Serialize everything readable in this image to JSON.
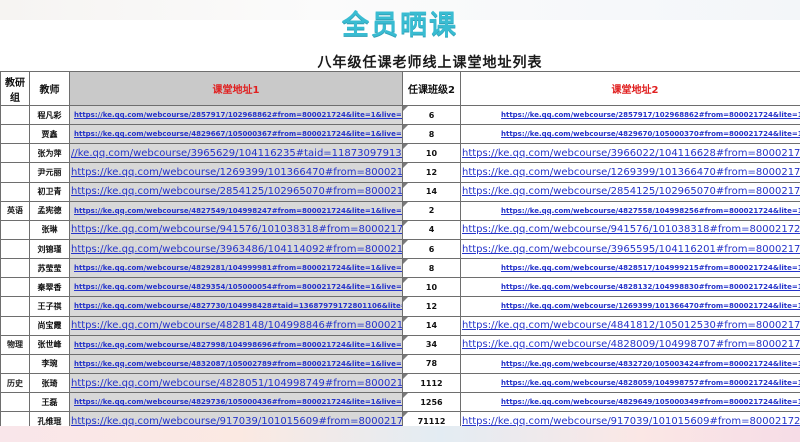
{
  "banner": {
    "title": "全员晒课"
  },
  "sheet": {
    "title": "八年级任课老师线上课堂地址列表",
    "headers": {
      "group": "教研组",
      "teacher": "教师",
      "url1": "课堂地址1",
      "class": "任课班级2",
      "url2": "课堂地址2"
    },
    "group_labels": {
      "english": "英语",
      "physics": "物理",
      "history": "历史"
    },
    "rows": [
      {
        "teacher": "程凡彩",
        "url1": "https://ke.qq.com/webcourse/2857917/102968862#from=800021724&lite=1&live=1",
        "cls": "6",
        "url2": "https://ke.qq.com/webcourse/2857917/102968862#from=800021724&lite=1&live=1",
        "s1": "small",
        "s2": "small"
      },
      {
        "teacher": "贾鑫",
        "url1": "https://ke.qq.com/webcourse/4829667/105000367#from=800021724&lite=1&live=1",
        "cls": "8",
        "url2": "https://ke.qq.com/webcourse/4829670/105000370#from=800021724&lite=1&live=1",
        "s1": "small",
        "s2": "small"
      },
      {
        "teacher": "张为萍",
        "url1": "//ke.qq.com/webcourse/3965629/104116235#taid=11873097913412458l",
        "cls": "10",
        "url2": "https://ke.qq.com/webcourse/3966022/104116628#from=800021724&lite=1&",
        "s1": "big",
        "s2": "big"
      },
      {
        "teacher": "尹元丽",
        "url1": "https://ke.qq.com/webcourse/1269399/101366470#from=800021724&lite=1",
        "cls": "12",
        "url2": "https://ke.qq.com/webcourse/1269399/101366470#from=800021724&lite=1&",
        "s1": "big",
        "s2": "big"
      },
      {
        "teacher": "初卫青",
        "url1": "https://ke.qq.com/webcourse/2854125/102965070#from=800021724&lite=1&live",
        "cls": "14",
        "url2": "https://ke.qq.com/webcourse/2854125/102965070#from=800021724&lite=1&",
        "s1": "big",
        "s2": "big"
      },
      {
        "teacher": "孟宪德",
        "url1": "https://ke.qq.com/webcourse/4827549/104998247#from=800021724&lite=1&live=1",
        "cls": "2",
        "url2": "https://ke.qq.com/webcourse/4827558/104998256#from=800021724&lite=1&live=1",
        "s1": "small",
        "s2": "small"
      },
      {
        "teacher": "张琳",
        "url1": "https://ke.qq.com/webcourse/941576/101038318#from=800021724&lite=1&live=",
        "cls": "4",
        "url2": "https://ke.qq.com/webcourse/941576/101038318#from=800021724&lite=1&",
        "s1": "big",
        "s2": "big"
      },
      {
        "teacher": "刘锦瑾",
        "url1": "https://ke.qq.com/webcourse/3963486/104114092#from=800021724&lite=1&live=",
        "cls": "6",
        "url2": "https://ke.qq.com/webcourse/3965595/104116201#from=800021724&lite=1&",
        "s1": "big",
        "s2": "big"
      },
      {
        "teacher": "苏莹莹",
        "url1": "https://ke.qq.com/webcourse/4829281/104999981#from=800021724&lite=1&live=1",
        "cls": "8",
        "url2": "https://ke.qq.com/webcourse/4828517/104999215#from=800021724&lite=1&live=1",
        "s1": "small",
        "s2": "small"
      },
      {
        "teacher": "秦翠香",
        "url1": "https://ke.qq.com/webcourse/4829354/105000054#from=800021724&lite=1&live=1",
        "cls": "10",
        "url2": "https://ke.qq.com/webcourse/4828132/104998830#from=800021724&lite=1&live=1",
        "s1": "small",
        "s2": "small"
      },
      {
        "teacher": "王子祺",
        "url1": "https://ke.qq.com/webcourse/4827730/104998428#taid=13687979172801106&lite=1",
        "cls": "12",
        "url2": "https://ke.qq.com/webcourse/1269399/101366470#from=800021724&lite=1&live=1",
        "s1": "small",
        "s2": "small"
      },
      {
        "teacher": "尚宝霞",
        "url1": "https://ke.qq.com/webcourse/4828148/104998846#from=800021724&lite=1&live=",
        "cls": "14",
        "url2": "https://ke.qq.com/webcourse/4841812/105012530#from=800021724&lite=1&",
        "s1": "big",
        "s2": "big"
      },
      {
        "teacher": "张世峰",
        "url1": "https://ke.qq.com/webcourse/4827998/104998696#from=800021724&lite=1&live=1",
        "cls": "34",
        "url2": "https://ke.qq.com/webcourse/4828009/104998707#from=800021724&lite=1&",
        "s1": "small",
        "s2": "big"
      },
      {
        "teacher": "李琬",
        "url1": "https://ke.qq.com/webcourse/4832087/105002789#from=800021724&lite=1&live=1",
        "cls": "78",
        "url2": "https://ke.qq.com/webcourse/4832720/105003424#from=800021724&lite=1&live=1",
        "s1": "small",
        "s2": "small"
      },
      {
        "teacher": "张琦",
        "url1": "https://ke.qq.com/webcourse/4828051/104998749#from=800021724&lite=1&live=",
        "cls": "1112",
        "url2": "https://ke.qq.com/webcourse/4828059/104998757#from=800021724&lite=1&live=1",
        "s1": "big",
        "s2": "small"
      },
      {
        "teacher": "王磊",
        "url1": "https://ke.qq.com/webcourse/4829736/105000436#from=800021724&lite=1&live=1",
        "cls": "1256",
        "url2": "https://ke.qq.com/webcourse/4829649/105000349#from=800021724&lite=1&live=1",
        "s1": "small",
        "s2": "small"
      },
      {
        "teacher": "孔维琨",
        "url1": "https://ke.qq.com/webcourse/917039/101015609#from=800021724&lite=1&live=",
        "cls": "71112",
        "url2": "https://ke.qq.com/webcourse/917039/101015609#from=800021724&lite=1&",
        "s1": "big",
        "s2": "big"
      }
    ]
  }
}
